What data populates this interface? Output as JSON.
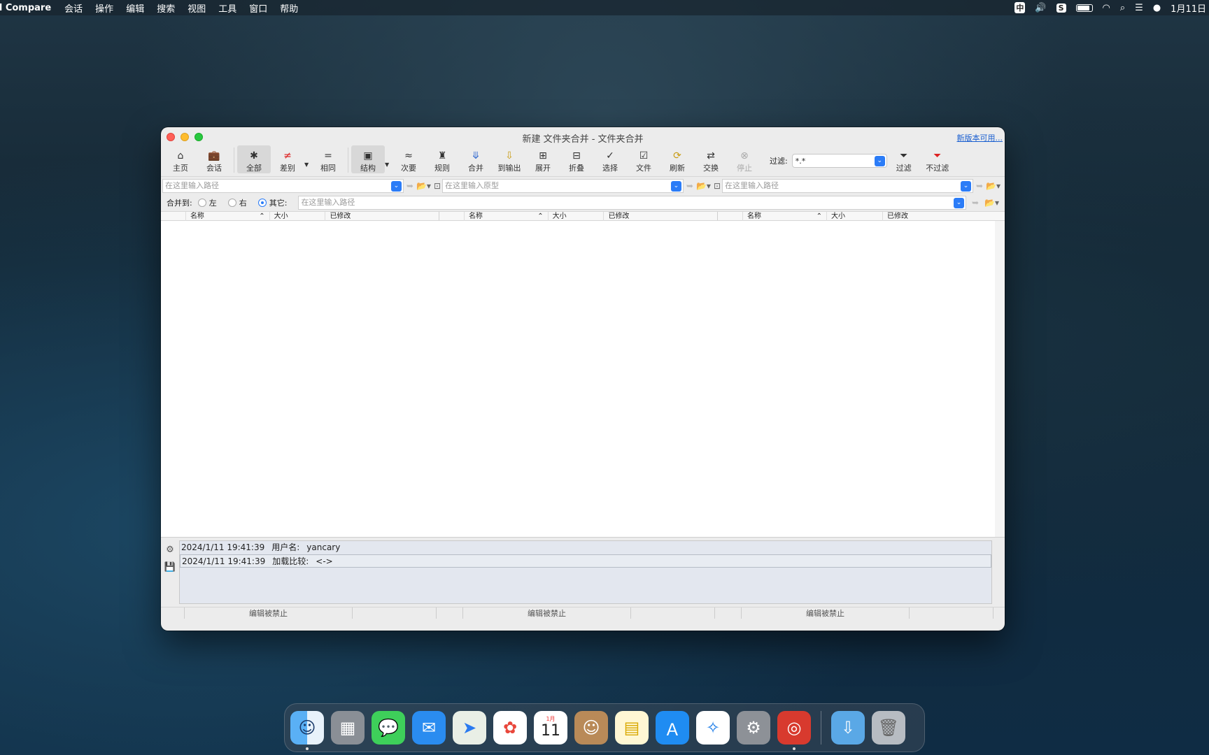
{
  "menubar": {
    "app_name": "d Compare",
    "items": [
      "会话",
      "操作",
      "编辑",
      "搜索",
      "视图",
      "工具",
      "窗口",
      "帮助"
    ],
    "ime": "中",
    "clock": "1月11日"
  },
  "window": {
    "title": "新建 文件夹合并 - 文件夹合并",
    "new_version": "新版本可用..."
  },
  "toolbar": {
    "home": "主页",
    "session": "会话",
    "all": "全部",
    "diff": "差别",
    "same": "相同",
    "structure": "结构",
    "minor": "次要",
    "rules": "规则",
    "merge": "合并",
    "to_output": "到输出",
    "expand": "展开",
    "collapse": "折叠",
    "select": "选择",
    "files": "文件",
    "refresh": "刷新",
    "swap": "交换",
    "stop": "停止",
    "filter_label": "过滤:",
    "filter_value": "*.*",
    "filter": "过滤",
    "no_filter": "不过滤"
  },
  "paths": {
    "left_placeholder": "在这里输入路径",
    "center_placeholder": "在这里输入原型",
    "right_placeholder": "在这里输入路径",
    "output_placeholder": "在这里输入路径"
  },
  "merge_to": {
    "label": "合并到:",
    "left": "左",
    "right": "右",
    "other": "其它:"
  },
  "columns": {
    "name": "名称",
    "size": "大小",
    "modified": "已修改"
  },
  "log": [
    {
      "time": "2024/1/11 19:41:39",
      "label": "用户名:",
      "value": "yancary"
    },
    {
      "time": "2024/1/11 19:41:39",
      "label": "加载比较:",
      "value": "<->"
    }
  ],
  "status": {
    "edit_disabled": "编辑被禁止"
  },
  "dock": {
    "calendar_month": "1月",
    "calendar_day": "11"
  },
  "colors": {
    "accent": "#2b7cf7",
    "close": "#ff5f57",
    "minimize": "#febc2e",
    "maximize": "#28c840"
  }
}
